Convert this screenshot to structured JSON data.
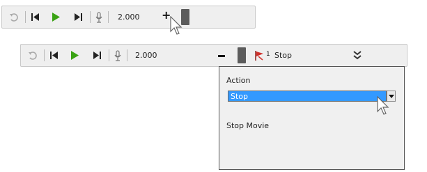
{
  "toolbar_top": {
    "value": "2.000",
    "icons": [
      "undo-icon",
      "first-frame-icon",
      "play-icon",
      "last-frame-icon",
      "microphone-icon",
      "plus-icon",
      "drag-grip-icon"
    ]
  },
  "toolbar_bottom": {
    "value": "2.000",
    "action_badge": "1",
    "action_label": "Stop",
    "icons": [
      "undo-icon",
      "first-frame-icon",
      "play-icon",
      "last-frame-icon",
      "microphone-icon",
      "minus-icon",
      "drag-grip-icon",
      "action-flag-icon",
      "expand-double-chevron-icon"
    ]
  },
  "panel": {
    "action_heading": "Action",
    "action_select_value": "Stop",
    "description": "Stop Movie"
  },
  "colors": {
    "toolbar_bg": "#efefef",
    "play_green": "#3aa314",
    "select_blue": "#3399ff",
    "flag_red": "#d0302a"
  }
}
